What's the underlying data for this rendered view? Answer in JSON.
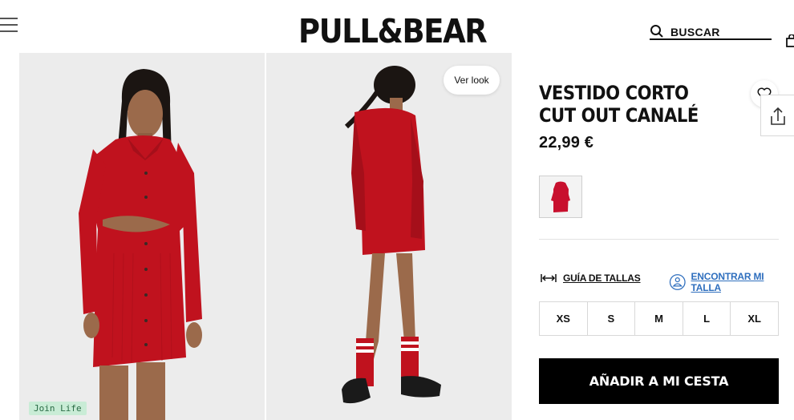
{
  "header": {
    "logo": "PULL&BEAR",
    "search_label": "BUSCAR",
    "menu_icon": "hamburger-menu-icon",
    "search_icon": "search-icon",
    "bag_icon": "shopping-bag-icon"
  },
  "gallery": {
    "badge": "Join Life",
    "ver_look": "Ver look"
  },
  "product": {
    "title": "VESTIDO CORTO CUT OUT CANALÉ",
    "price": "22,99 €",
    "color_hex": "#c8102e"
  },
  "sizing": {
    "guide_label": "GUÍA DE TALLAS",
    "find_label": "ENCONTRAR MI TALLA",
    "sizes": [
      "XS",
      "S",
      "M",
      "L",
      "XL"
    ]
  },
  "cta": {
    "add_label": "AÑADIR A MI CESTA"
  },
  "colors": {
    "accent_link": "#2f6fbe",
    "join_life_bg": "#c9ecd6",
    "cta_bg": "#000000"
  }
}
